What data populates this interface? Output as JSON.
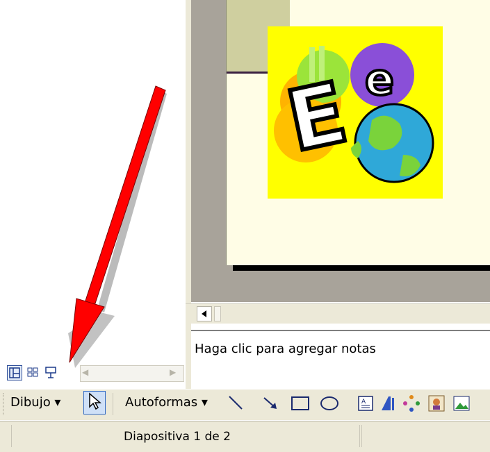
{
  "notes": {
    "placeholder_text": "Haga clic para agregar notas"
  },
  "view_buttons": {
    "normal_icon": "normal-view-icon",
    "sorter_icon": "slide-sorter-icon",
    "slideshow_icon": "slideshow-icon"
  },
  "toolbar": {
    "draw_menu_label": "Dibujo ▾",
    "autoshapes_menu_label": "Autoformas ▾",
    "tools": [
      "select-pointer-icon",
      "line-icon",
      "arrow-icon",
      "rectangle-icon",
      "oval-icon",
      "textbox-icon",
      "wordart-icon",
      "diagram-icon",
      "clipart-icon",
      "picture-icon"
    ]
  },
  "status_bar": {
    "slide_position": "Diapositiva 1 de 2"
  },
  "slide": {
    "clipart_text": "E e"
  },
  "colors": {
    "annotation_arrow": "#ff0000",
    "clipart_background": "#ffff00",
    "toolbar_background": "#ece9d8",
    "slide_background": "#fffde6"
  }
}
